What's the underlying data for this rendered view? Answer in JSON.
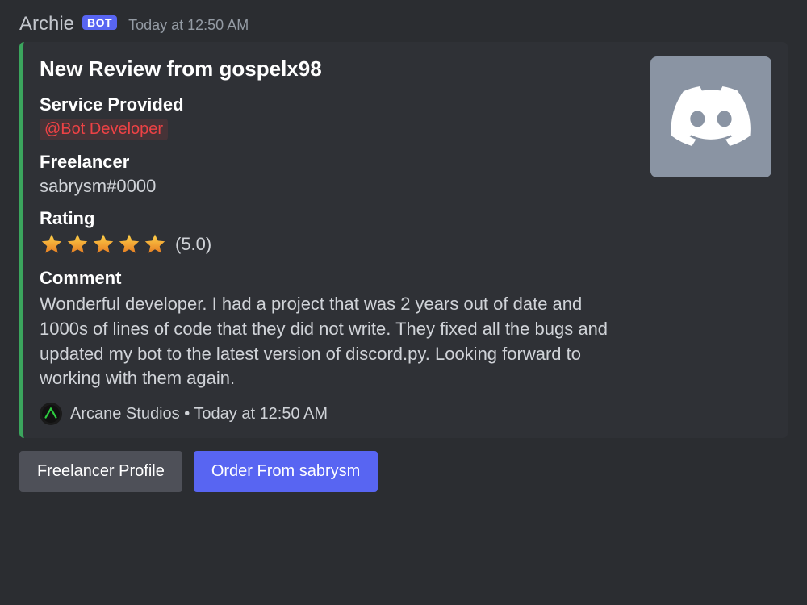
{
  "header": {
    "author": "Archie",
    "bot_tag": "BOT",
    "timestamp": "Today at 12:50 AM"
  },
  "embed": {
    "accent_color": "#3ba55d",
    "title": "New Review from gospelx98",
    "service": {
      "label": "Service Provided",
      "mention": "@Bot Developer"
    },
    "freelancer": {
      "label": "Freelancer",
      "value": "sabrysm#0000"
    },
    "rating": {
      "label": "Rating",
      "value_text": "(5.0)",
      "stars": 5
    },
    "comment": {
      "label": "Comment",
      "text": "Wonderful developer. I had a project that was 2 years out of date and 1000s of lines of code that they did not write. They fixed all the bugs and updated my bot to the latest version of discord.py. Looking forward to working with them again."
    },
    "footer": {
      "icon_name": "arcane-studios-icon",
      "text": "Arcane Studios • Today at 12:50 AM"
    },
    "thumbnail_icon": "discord-logo"
  },
  "buttons": {
    "profile": "Freelancer Profile",
    "order": "Order From sabrysm"
  }
}
